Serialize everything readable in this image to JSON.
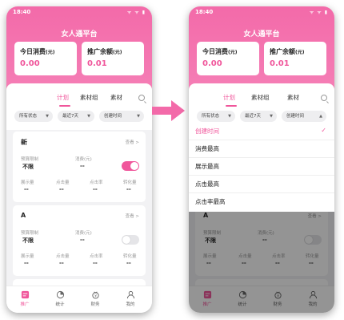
{
  "status": {
    "time": "18:40",
    "icons": "ᯤ ᯤ ▮"
  },
  "app": {
    "title": "女人通平台"
  },
  "cards": {
    "today_label": "今日消费",
    "today_unit": "(元)",
    "today_value": "0.00",
    "balance_label": "推广余额",
    "balance_unit": "(元)",
    "balance_value": "0.01"
  },
  "tabs": [
    "计划",
    "素材组",
    "素材"
  ],
  "filters": {
    "status": "所有状态",
    "range": "最近7天",
    "sort_left": "创建时间",
    "sort_right": "创建时间"
  },
  "ads": [
    {
      "title": "新",
      "view": "查看 >",
      "budget_label": "预算限制",
      "budget_value": "不限",
      "spend_label": "消费(元)",
      "spend_value": "--",
      "toggle": "on"
    },
    {
      "title": "A",
      "view": "查看 >",
      "budget_label": "预算限制",
      "budget_value": "不限",
      "spend_label": "消费(元)",
      "spend_value": "--",
      "toggle": "off"
    }
  ],
  "metrics": {
    "labels": [
      "展示量",
      "点击量",
      "点击率",
      "转化量"
    ],
    "values": [
      "--",
      "--",
      "--",
      "--"
    ]
  },
  "tabbar": [
    {
      "label": "推广",
      "icon": "promote-icon"
    },
    {
      "label": "统计",
      "icon": "stats-icon"
    },
    {
      "label": "财务",
      "icon": "finance-icon"
    },
    {
      "label": "我的",
      "icon": "profile-icon"
    }
  ],
  "dropdown": {
    "items": [
      "创建时间",
      "消费最高",
      "展示最高",
      "点击最高",
      "点击率最高"
    ],
    "selected_index": 0
  },
  "colors": {
    "accent": "#f0569b",
    "header": "#f36aa9"
  }
}
